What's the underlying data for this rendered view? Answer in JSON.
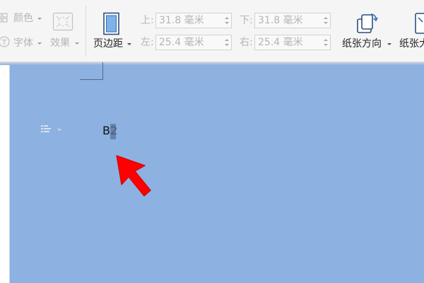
{
  "ribbon": {
    "colors_label": "颜色",
    "fonts_label": "字体",
    "effects_label": "效果",
    "margins_label": "页边距",
    "top_label": "上:",
    "top_value": "31.8 毫米",
    "bottom_label": "下:",
    "bottom_value": "31.8 毫米",
    "left_label": "左:",
    "left_value": "25.4 毫米",
    "right_label": "右:",
    "right_value": "25.4 毫米",
    "orientation_label": "纸张方向",
    "size_label": "纸张大"
  },
  "document": {
    "cell_text": "B2"
  },
  "colors": {
    "workspace_bg": "#8db1e1",
    "ribbon_bg": "#f5f5f5",
    "arrow": "#ff0000"
  },
  "icons": {
    "margins": "page-margins-icon",
    "orientation": "paper-orientation-icon",
    "size": "paper-size-icon",
    "arrow": "red-pointer-arrow"
  }
}
